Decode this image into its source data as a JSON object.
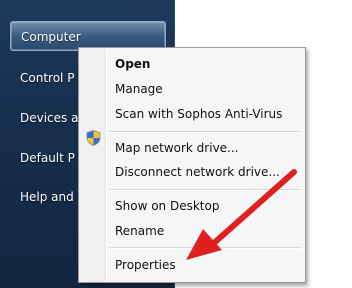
{
  "start_menu": {
    "items": [
      {
        "label": "Computer"
      },
      {
        "label": "Control P"
      },
      {
        "label": "Devices a"
      },
      {
        "label": "Default P"
      },
      {
        "label": "Help and"
      }
    ]
  },
  "context_menu": {
    "items": [
      {
        "label": "Open"
      },
      {
        "label": "Manage"
      },
      {
        "label": "Scan with Sophos Anti-Virus"
      },
      {
        "label": "Map network drive..."
      },
      {
        "label": "Disconnect network drive..."
      },
      {
        "label": "Show on Desktop"
      },
      {
        "label": "Rename"
      },
      {
        "label": "Properties"
      }
    ]
  },
  "icons": {
    "manage": "uac-shield-icon",
    "annotation": "red-arrow"
  },
  "colors": {
    "start_menu_bg": "#17304f",
    "menu_bg": "#f5f6f8",
    "arrow": "#e0201f"
  }
}
